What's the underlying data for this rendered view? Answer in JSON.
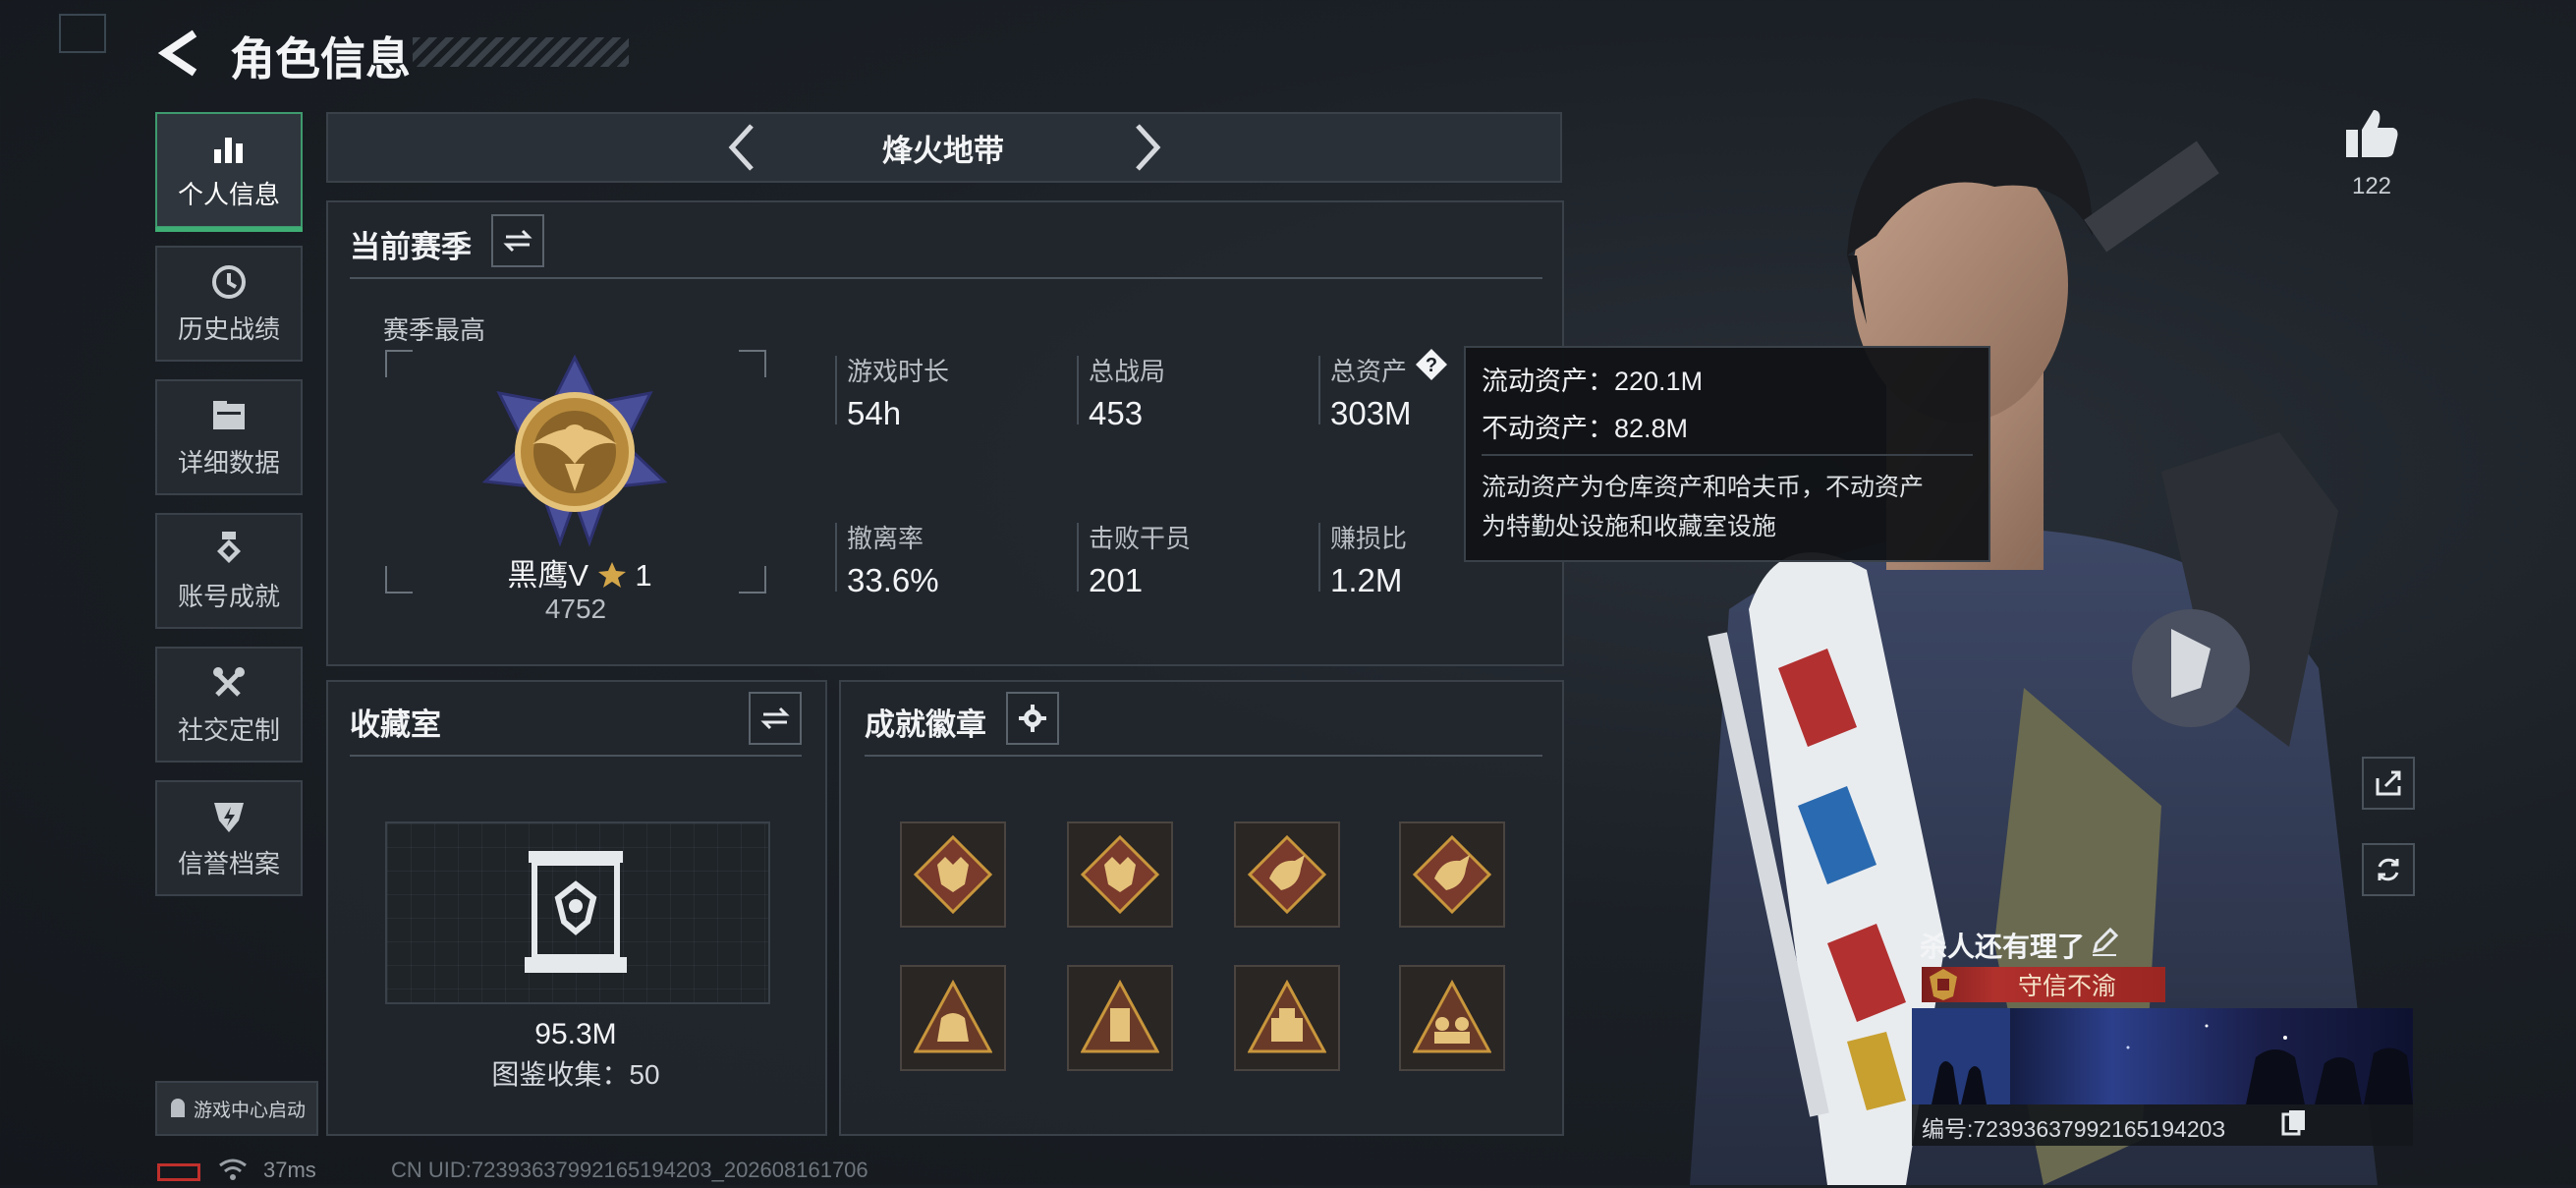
{
  "header": {
    "title": "角色信息"
  },
  "sidebar": {
    "items": [
      {
        "label": "个人信息",
        "active": true
      },
      {
        "label": "历史战绩"
      },
      {
        "label": "详细数据"
      },
      {
        "label": "账号成就"
      },
      {
        "label": "社交定制"
      },
      {
        "label": "信誉档案"
      }
    ],
    "game_center": "游戏中心启动"
  },
  "mode_selector": {
    "label": "烽火地带"
  },
  "season": {
    "title": "当前赛季",
    "highest_label": "赛季最高",
    "rank_name": "黑鹰V",
    "rank_stars": "1",
    "rank_points": "4752",
    "stats": [
      {
        "label": "游戏时长",
        "value": "54h"
      },
      {
        "label": "总战局",
        "value": "453"
      },
      {
        "label": "总资产",
        "value": "303M"
      },
      {
        "label": "撤离率",
        "value": "33.6%"
      },
      {
        "label": "击败干员",
        "value": "201"
      },
      {
        "label": "赚损比",
        "value": "1.2M"
      }
    ]
  },
  "tooltip": {
    "liquid": "流动资产：220.1M",
    "fixed": "不动资产：82.8M",
    "desc_line1": "流动资产为仓库资产和哈夫币，不动资产",
    "desc_line2": "为特勤处设施和收藏室设施"
  },
  "collection": {
    "title": "收藏室",
    "value": "95.3M",
    "catalog": "图鉴收集：50"
  },
  "achievements": {
    "title": "成就徽章"
  },
  "likes": {
    "count": "122"
  },
  "profile": {
    "nickname": "杀人还有理了",
    "title_badge": "守信不渝",
    "serial": "编号:7239363799216519420З"
  },
  "status_bar": {
    "ping": "37ms",
    "uid": "CN UID:72393637992165194203_202608161706"
  },
  "colors": {
    "accent_green": "#3fae74",
    "title_badge_red": "#b0302c",
    "gold": "#c8963c"
  }
}
